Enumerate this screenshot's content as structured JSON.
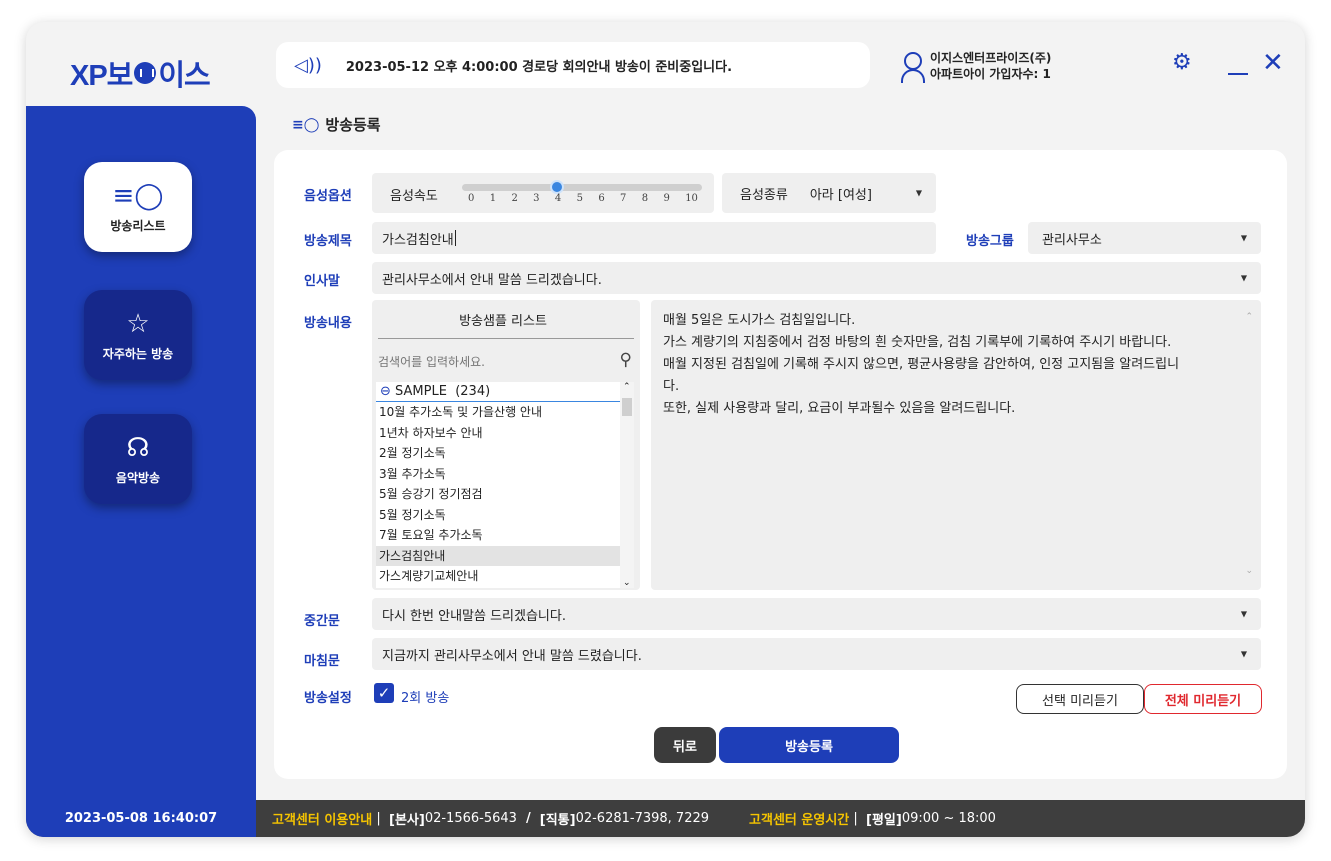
{
  "app": {
    "logo_text_pre": "XP보",
    "logo_text_post": "이스"
  },
  "header": {
    "notice": "2023-05-12 오후 4:00:00 경로당 회의안내 방송이 준비중입니다.",
    "user_name": "이지스엔터프라이즈(주)",
    "user_sub": "아파트아이 가입자수: 1"
  },
  "sidebar": {
    "items": [
      {
        "label": "방송리스트",
        "icon": "mic-list-icon"
      },
      {
        "label": "자주하는 방송",
        "icon": "star-icon"
      },
      {
        "label": "음악방송",
        "icon": "headphones-icon"
      }
    ]
  },
  "page": {
    "title": "방송등록"
  },
  "form": {
    "voice_option_label": "음성옵션",
    "speed_label": "음성속도",
    "speed_value": 4,
    "speed_ticks": [
      "0",
      "1",
      "2",
      "3",
      "4",
      "5",
      "6",
      "7",
      "8",
      "9",
      "10"
    ],
    "voice_type_label": "음성종류",
    "voice_type_value": "아라 [여성]",
    "title_label": "방송제목",
    "title_value": "가스검침안내",
    "group_label": "방송그룹",
    "group_value": "관리사무소",
    "greeting_label": "인사말",
    "greeting_value": "관리사무소에서 안내 말씀 드리겠습니다.",
    "content_label": "방송내용",
    "sample_list_title": "방송샘플 리스트",
    "search_placeholder": "검색어를 입력하세요.",
    "sample_group": "SAMPLE",
    "sample_count": "(234)",
    "samples": [
      "10월 추가소독 및 가을산행 안내",
      "1년차 하자보수 안내",
      "2월 정기소독",
      "3월 추가소독",
      "5월 승강기 정기점검",
      "5월 정기소독",
      "7월 토요일 추가소독",
      "가스검침안내",
      "가스계량기교체안내"
    ],
    "selected_sample": "가스검침안내",
    "content_lines": [
      "매월 5일은 도시가스 검침일입니다.",
      "가스 계량기의 지침중에서 검정 바탕의 흰 숫자만을, 검침 기록부에 기록하여 주시기 바랍니다.",
      "매월 지정된 검침일에 기록해 주시지 않으면, 평균사용량을 감안하여, 인정 고지됨을 알려드립니",
      "다.",
      "또한, 실제 사용량과 달리, 요금이 부과될수 있음을 알려드립니다."
    ],
    "middle_label": "중간문",
    "middle_value": "다시 한번 안내말씀 드리겠습니다.",
    "closing_label": "마침문",
    "closing_value": "지금까지 관리사무소에서 안내 말씀 드렸습니다.",
    "settings_label": "방송설정",
    "repeat_label": "2회 방송",
    "repeat_checked": true,
    "preview_selected": "선택 미리듣기",
    "preview_all": "전체 미리듣기",
    "back": "뒤로",
    "register": "방송등록"
  },
  "footer": {
    "datetime": "2023-05-08 16:40:07",
    "cs_label": "고객센터 이용안내",
    "hq_tag": "[본사]",
    "hq_phone": "02-1566-5643",
    "direct_tag": "[직통]",
    "direct_phone": "02-6281-7398, 7229",
    "hours_label": "고객센터 운영시간",
    "weekday_tag": "[평일]",
    "weekday_hours": "09:00 ~ 18:00"
  },
  "colors": {
    "brand": "#1e3eb8",
    "accent_red": "#e0282e",
    "footer_yellow": "#f5c400"
  }
}
